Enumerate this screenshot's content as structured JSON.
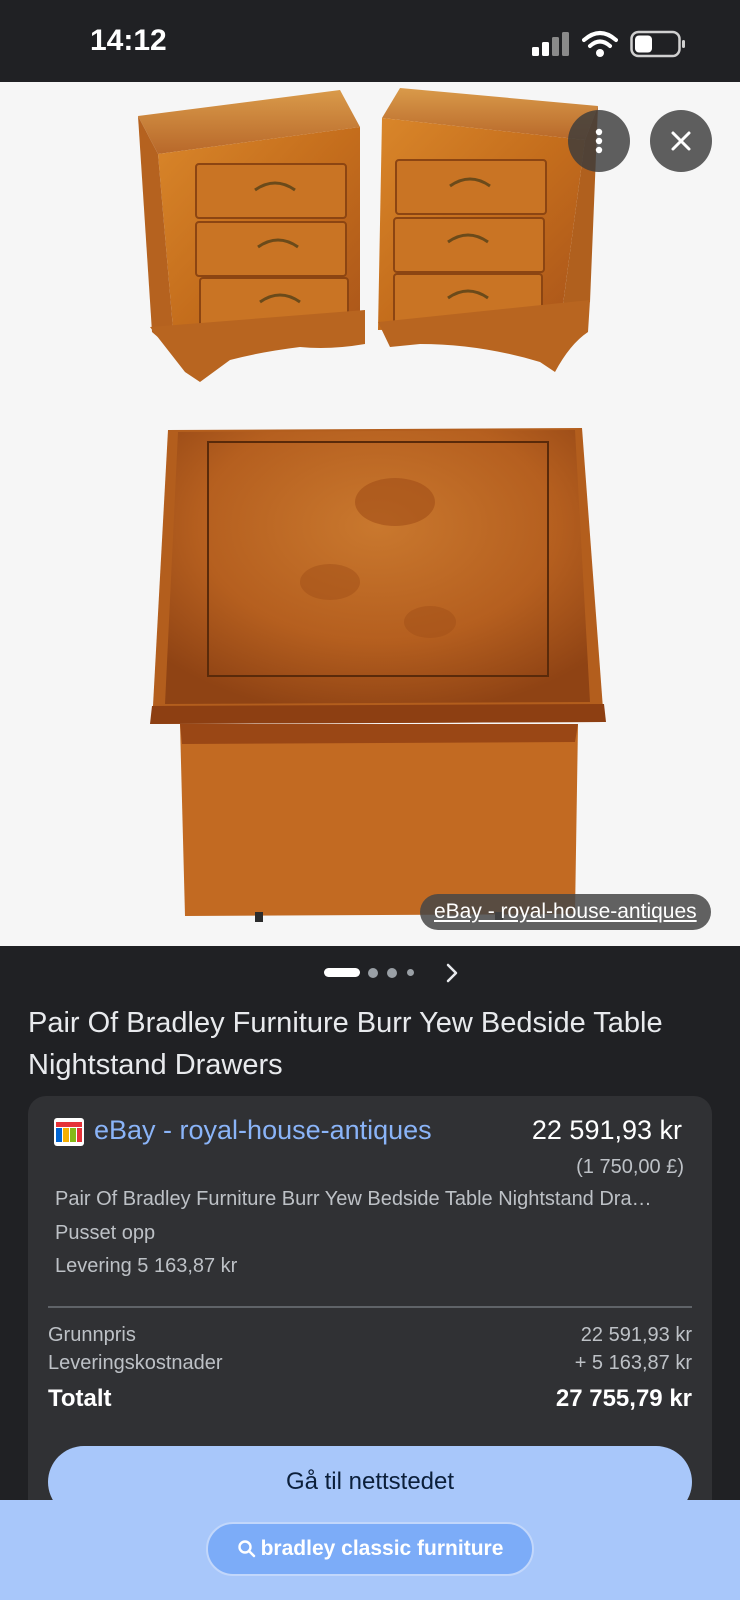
{
  "status_bar": {
    "time": "14:12"
  },
  "viewer": {
    "source_label": "eBay - royal-house-antiques",
    "icons": {
      "more": "more-vert-icon",
      "close": "close-icon"
    }
  },
  "pager": {
    "total_dots": 4,
    "active_index": 0
  },
  "product": {
    "title": "Pair Of Bradley Furniture Burr Yew Bedside Table Nightstand Drawers"
  },
  "offer": {
    "merchant": "eBay - royal-house-antiques",
    "price": "22 591,93 kr",
    "original_price": "(1 750,00 £)",
    "description": "Pair Of Bradley Furniture Burr Yew Bedside Table Nightstand Drawers",
    "condition": "Pusset opp",
    "delivery": "Levering 5 163,87 kr",
    "breakdown": {
      "base_label": "Grunnpris",
      "base_value": "22 591,93 kr",
      "shipping_label": "Leveringskostnader",
      "shipping_value": "+ 5 163,87 kr",
      "total_label": "Totalt",
      "total_value": "27 755,79 kr"
    },
    "visit_label": "Gå til nettstedet"
  },
  "search": {
    "query": "bradley classic furniture"
  },
  "colors": {
    "background": "#202124",
    "card": "#303134",
    "link": "#8ab4f8",
    "accent_button": "#a8c7fa",
    "viewer_bg": "#f6f6f6"
  }
}
